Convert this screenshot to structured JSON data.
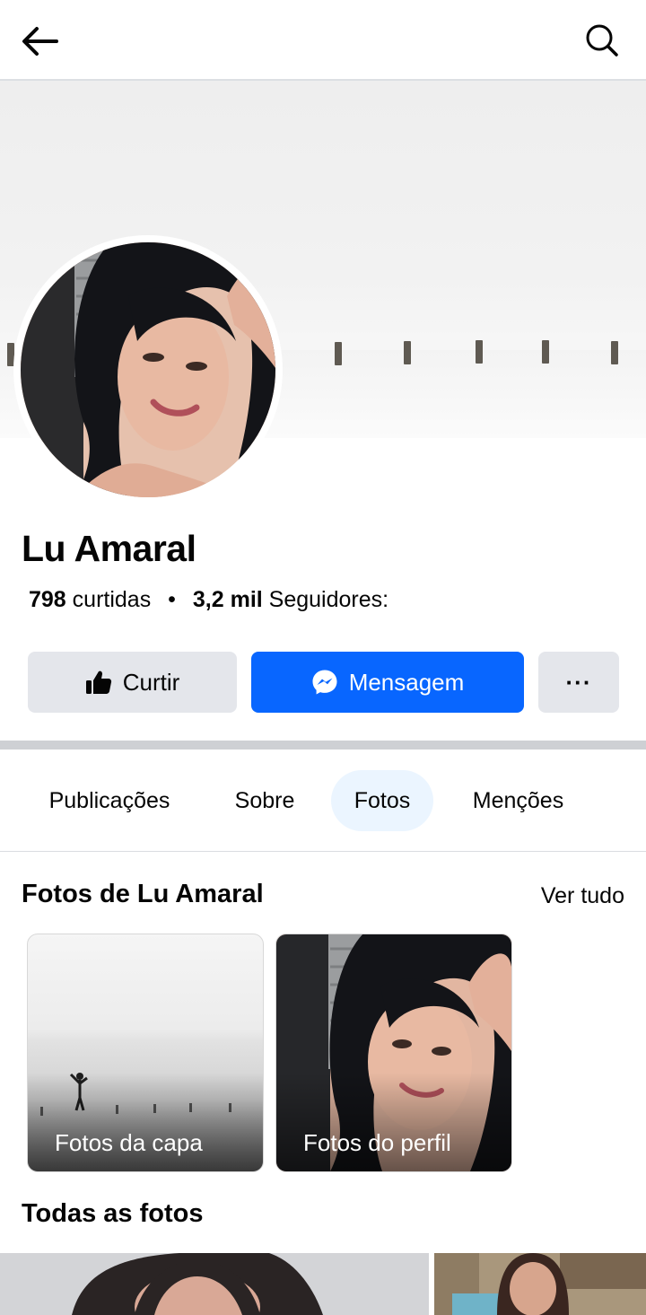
{
  "header": {
    "back_icon": "arrow-left-icon",
    "search_icon": "search-icon"
  },
  "profile": {
    "name": "Lu Amaral",
    "likes_count": "798",
    "likes_label": "curtidas",
    "separator": "•",
    "followers_count": "3,2 mil",
    "followers_label": "Seguidores:"
  },
  "actions": {
    "like_label": "Curtir",
    "message_label": "Mensagem",
    "more_label": "···",
    "accent_color": "#0866ff"
  },
  "tabs": [
    {
      "label": "Publicações",
      "active": false
    },
    {
      "label": "Sobre",
      "active": false
    },
    {
      "label": "Fotos",
      "active": true
    },
    {
      "label": "Menções",
      "active": false
    }
  ],
  "photos_section": {
    "title": "Fotos de Lu Amaral",
    "see_all": "Ver tudo",
    "albums": [
      {
        "label": "Fotos da capa"
      },
      {
        "label": "Fotos do perfil"
      }
    ]
  },
  "all_photos": {
    "title": "Todas as fotos"
  }
}
